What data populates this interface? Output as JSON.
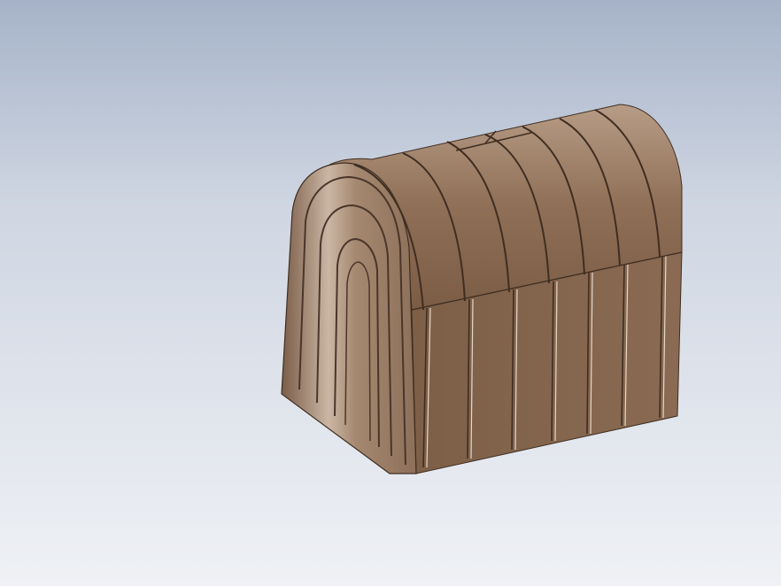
{
  "viewport": {
    "background_top": "#a6b3c8",
    "background_bottom": "#eff1f5"
  },
  "model": {
    "name": "corrugated-arch-box",
    "material_color": "#8b6a52",
    "front_face_color": "#9c7d64",
    "highlight_color": "#d8cabc",
    "edge_color": "#3f2e22",
    "rib_count": 8
  }
}
